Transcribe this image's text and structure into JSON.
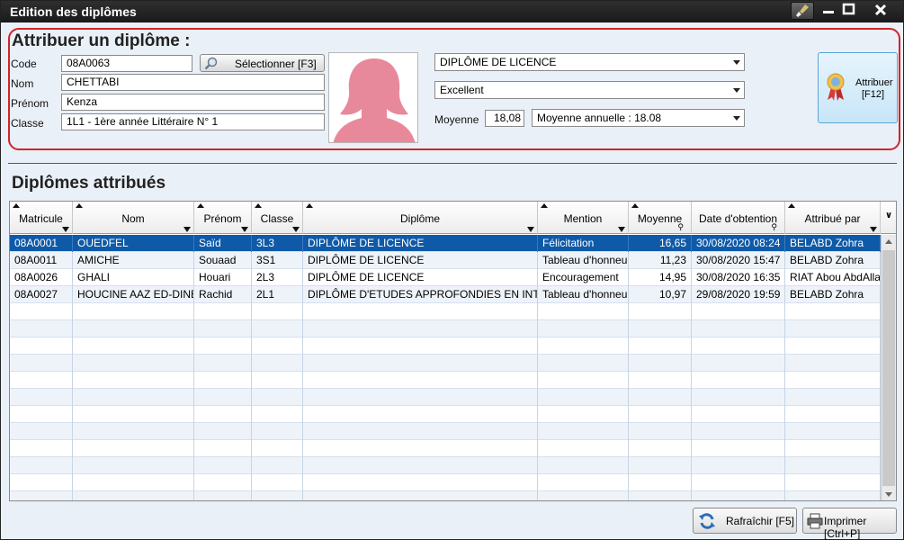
{
  "window": {
    "title": "Edition des diplômes"
  },
  "form": {
    "section_title": "Attribuer un diplôme :",
    "code_label": "Code",
    "code_value": "08A0063",
    "select_button": "Sélectionner [F3]",
    "nom_label": "Nom",
    "nom_value": "CHETTABI",
    "prenom_label": "Prénom",
    "prenom_value": "Kenza",
    "classe_label": "Classe",
    "classe_value": "1L1 - 1ère année Littéraire N° 1",
    "diplome_value": "DIPLÔME DE LICENCE",
    "mention_value": "Excellent",
    "moyenne_label": "Moyenne",
    "moyenne_value": "18,08",
    "moyenne_type_value": "Moyenne annuelle : 18.08",
    "attribuer_button": "Attribuer",
    "attribuer_shortcut": "[F12]"
  },
  "list": {
    "section_title": "Diplômes attribués",
    "columns": [
      "Matricule",
      "Nom",
      "Prénom",
      "Classe",
      "Diplôme",
      "Mention",
      "Moyenne",
      "Date d'obtention",
      "Attribué par"
    ],
    "rows": [
      [
        "08A0001",
        "OUEDFEL",
        "Saïd",
        "3L3",
        "DIPLÔME DE LICENCE",
        "Félicitation",
        "16,65",
        "30/08/2020 08:24",
        "BELABD Zohra"
      ],
      [
        "08A0011",
        "AMICHE",
        "Souaad",
        "3S1",
        "DIPLÔME DE LICENCE",
        "Tableau d'honneur",
        "11,23",
        "30/08/2020 15:47",
        "BELABD Zohra"
      ],
      [
        "08A0026",
        "GHALI",
        "Houari",
        "2L3",
        "DIPLÔME DE LICENCE",
        "Encouragement",
        "14,95",
        "30/08/2020 16:35",
        "RIAT Abou AbdAllah"
      ],
      [
        "08A0027",
        "HOUCINE AAZ ED-DINE",
        "Rachid",
        "2L1",
        "DIPLÔME D'ETUDES APPROFONDIES EN INTELLI",
        "Tableau d'honneur",
        "10,97",
        "29/08/2020 19:59",
        "BELABD Zohra"
      ]
    ]
  },
  "footer": {
    "refresh_button": "Rafraîchir [F5]",
    "print_button": "Imprimer [Ctrl+P]"
  },
  "colors": {
    "selection": "#0f5aa8",
    "panel_border": "#d2232a",
    "avatar": "#e8899b"
  },
  "icons": [
    "brush-icon",
    "minimize-icon",
    "maximize-icon",
    "close-icon",
    "search-icon",
    "avatar-icon",
    "award-ribbon-icon",
    "refresh-icon",
    "printer-icon"
  ]
}
